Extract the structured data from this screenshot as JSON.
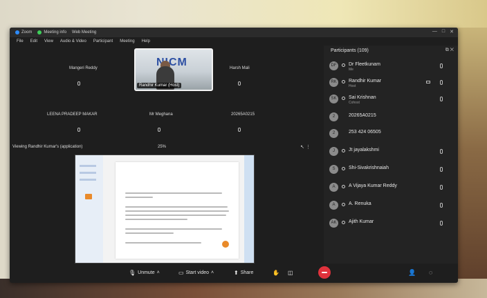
{
  "titlebar": {
    "app": "Zoom",
    "meeting_info": "Meeting info",
    "third": "Web Meeting"
  },
  "menubar": [
    "File",
    "Edit",
    "View",
    "Audio & Video",
    "Participant",
    "Meeting",
    "Help"
  ],
  "tiles": [
    {
      "name": "Mangeri Reddy"
    },
    {
      "name": "Harsh Mali"
    },
    {
      "name": "LEENA PRADEEP MAKAR"
    },
    {
      "name": "Mr Meghana"
    },
    {
      "name": "20265A0215"
    }
  ],
  "speaker": {
    "banner": "NICM",
    "name": "Randhir Kumar (Host)"
  },
  "share": {
    "label": "Viewing Randhir Kumar's (application)",
    "zoom": "25%"
  },
  "toolbar": {
    "unmute": "Unmute",
    "start_video": "Start video",
    "share": "Share"
  },
  "participants": {
    "title": "Participants (109)",
    "list": [
      {
        "name": "Dr Fleetkunam",
        "sub": "Me",
        "initials": "DF"
      },
      {
        "name": "Randhir Kumar",
        "sub": "Host",
        "initials": "RK"
      },
      {
        "name": "Sai Krishnan",
        "sub": "Cohost",
        "initials": "SK"
      },
      {
        "name": "20265A0215",
        "sub": "",
        "initials": "2"
      },
      {
        "name": "253 424 06505",
        "sub": "",
        "initials": "2"
      },
      {
        "name": "Jt jayalakshmi",
        "sub": "",
        "initials": "J"
      },
      {
        "name": "Shi-Sivakrishnaiah",
        "sub": "",
        "initials": "S"
      },
      {
        "name": "A Vijaya Kumar Reddy",
        "sub": "",
        "initials": "A"
      },
      {
        "name": "A. Renuka",
        "sub": "",
        "initials": "A"
      },
      {
        "name": "Ajith Kumar",
        "sub": "",
        "initials": "AK"
      }
    ]
  },
  "colors": {
    "end_button": "#e0323c",
    "zoom_blue": "#2d8cff"
  },
  "icons": {
    "mic": "mic-icon",
    "video": "video-icon",
    "share": "share-screen-icon"
  }
}
